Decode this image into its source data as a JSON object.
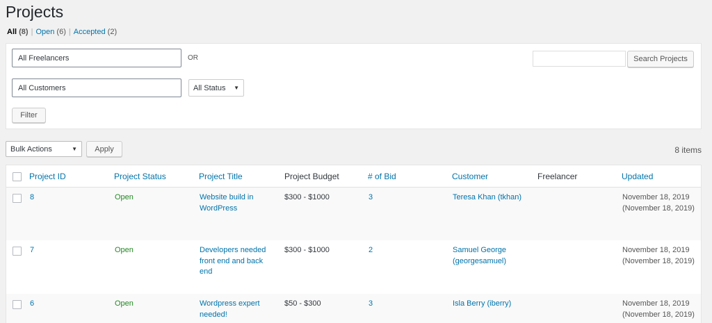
{
  "page": {
    "title": "Projects"
  },
  "views": [
    {
      "label": "All",
      "count": "(8)"
    },
    {
      "label": "Open",
      "count": "(6)"
    },
    {
      "label": "Accepted",
      "count": "(2)"
    }
  ],
  "filters": {
    "freelancers_value": "All Freelancers",
    "or_label": "OR",
    "customers_value": "All Customers",
    "status_value": "All Status",
    "filter_button": "Filter",
    "search_value": "",
    "search_button": "Search Projects"
  },
  "bulk": {
    "action_value": "Bulk Actions",
    "apply_button": "Apply"
  },
  "items_count": "8 items",
  "table": {
    "columns": [
      "Project ID",
      "Project Status",
      "Project Title",
      "Project Budget",
      "# of Bid",
      "Customer",
      "Freelancer",
      "Updated"
    ],
    "rows": [
      {
        "id": "8",
        "status": "Open",
        "title_lines": [
          "Website build in",
          "WordPress"
        ],
        "budget": "$300 - $1000",
        "bids": "3",
        "customer_lines": [
          "Teresa Khan (tkhan)"
        ],
        "freelancer": "",
        "updated_lines": [
          "November 18, 2019",
          "(November 18, 2019)"
        ]
      },
      {
        "id": "7",
        "status": "Open",
        "title_lines": [
          "Developers needed",
          "front end and back",
          "end"
        ],
        "budget": "$300 - $1000",
        "bids": "2",
        "customer_lines": [
          "Samuel George",
          "(georgesamuel)"
        ],
        "freelancer": "",
        "updated_lines": [
          "November 18, 2019",
          "(November 18, 2019)"
        ]
      },
      {
        "id": "6",
        "status": "Open",
        "title_lines": [
          "Wordpress expert",
          "needed!"
        ],
        "budget": "$50 - $300",
        "bids": "3",
        "customer_lines": [
          "Isla Berry (iberry)"
        ],
        "freelancer": "",
        "updated_lines": [
          "November 18, 2019",
          "(November 18, 2019)"
        ]
      }
    ]
  }
}
